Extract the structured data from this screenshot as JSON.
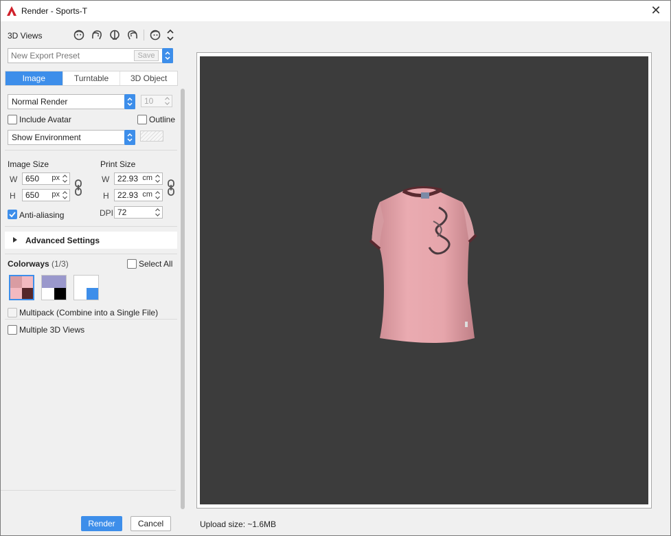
{
  "window": {
    "title": "Render - Sports-T",
    "close_glyph": "✕"
  },
  "views": {
    "label": "3D Views"
  },
  "preset": {
    "placeholder": "New Export Preset",
    "save_label": "Save"
  },
  "tabs": [
    {
      "label": "Image",
      "active": true
    },
    {
      "label": "Turntable",
      "active": false
    },
    {
      "label": "3D Object",
      "active": false
    }
  ],
  "render_mode": {
    "selected": "Normal Render"
  },
  "quality_value": "10",
  "include_avatar": {
    "label": "Include Avatar",
    "checked": false
  },
  "outline": {
    "label": "Outline",
    "checked": false
  },
  "environment": {
    "selected": "Show Environment"
  },
  "image_size": {
    "heading": "Image Size",
    "w_label": "W",
    "w_value": "650",
    "w_unit": "px",
    "h_label": "H",
    "h_value": "650",
    "h_unit": "px"
  },
  "print_size": {
    "heading": "Print Size",
    "w_label": "W",
    "w_value": "22.93",
    "w_unit": "cm",
    "h_label": "H",
    "h_value": "22.93",
    "h_unit": "cm",
    "dpi_label": "DPI",
    "dpi_value": "72"
  },
  "anti_aliasing": {
    "label": "Anti-aliasing",
    "checked": true
  },
  "advanced": {
    "label": "Advanced Settings"
  },
  "colorways": {
    "heading": "Colorways",
    "count": "(1/3)",
    "select_all_label": "Select All",
    "swatches": [
      {
        "colors": [
          "#d99ca2",
          "#f3b9c0",
          "#f3b9c0",
          "#55262a"
        ],
        "selected": true
      },
      {
        "colors": [
          "#9a98cc",
          "#9a98cc",
          "#ffffff",
          "#000000"
        ],
        "selected": false
      },
      {
        "colors": [
          "#ffffff",
          "#ffffff",
          "#ffffff",
          "#3d8eea"
        ],
        "selected": false
      }
    ]
  },
  "multipack": {
    "label": "Multipack (Combine into a Single File)",
    "checked": false
  },
  "multiple_views": {
    "label": "Multiple 3D Views",
    "checked": false
  },
  "actions": {
    "render_label": "Render",
    "cancel_label": "Cancel"
  },
  "upload": {
    "text": "Upload size: ~1.6MB"
  },
  "colors": {
    "accent": "#3d8eea",
    "viewport_bg": "#3c3c3c",
    "shirt": "#e8a7ad",
    "trim": "#5a2a30"
  }
}
